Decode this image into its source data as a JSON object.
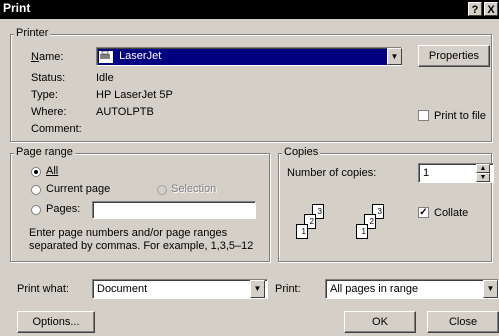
{
  "window": {
    "title": "Print",
    "help_label": "?",
    "close_label": "X"
  },
  "printer": {
    "group_label": "Printer",
    "name_label": "Name:",
    "name_value": "LaserJet",
    "properties_label": "Properties",
    "status_label": "Status:",
    "status_value": "Idle",
    "type_label": "Type:",
    "type_value": "HP LaserJet 5P",
    "where_label": "Where:",
    "where_value": "AUTOLPTB",
    "comment_label": "Comment:",
    "comment_value": "",
    "print_to_file_label": "Print to file",
    "print_to_file_checked": false
  },
  "page_range": {
    "group_label": "Page range",
    "all_label": "All",
    "current_page_label": "Current page",
    "selection_label": "Selection",
    "pages_label": "Pages:",
    "pages_value": "",
    "selected": "all",
    "hint_line1": "Enter page numbers and/or page ranges",
    "hint_line2": "separated by commas.  For example, 1,3,5–12"
  },
  "copies": {
    "group_label": "Copies",
    "number_label": "Number of copies:",
    "number_value": "1",
    "collate_label": "Collate",
    "collate_checked": true,
    "page_numbers": [
      "3",
      "2",
      "1"
    ]
  },
  "print_what": {
    "label": "Print what:",
    "value": "Document"
  },
  "print": {
    "label": "Print:",
    "value": "All pages in range"
  },
  "buttons": {
    "options": "Options...",
    "ok": "OK",
    "close": "Close"
  },
  "icons": {
    "dropdown_arrow": "▼",
    "spin_up": "▲",
    "spin_down": "▼",
    "check_mark": "✓"
  }
}
